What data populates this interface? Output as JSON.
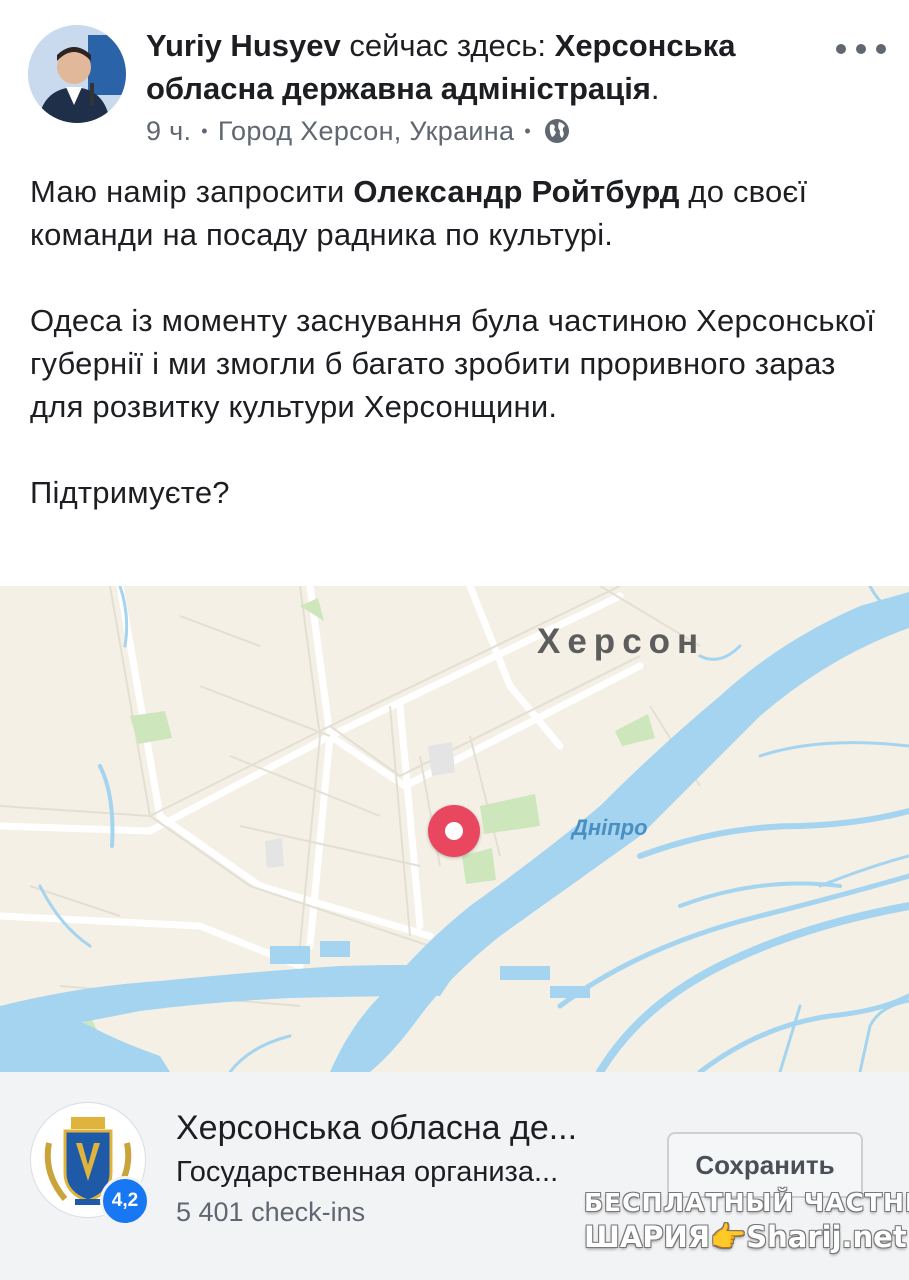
{
  "post": {
    "author": "Yuriy Husyev",
    "action": " сейчас здесь: ",
    "place_link": "Херсонська обласна державна адміністрація",
    "period": ".",
    "time": "9 ч.",
    "location": "Город Херсон, Украина",
    "privacy_icon": "globe-icon",
    "more_icon": "more-options-icon",
    "body": {
      "p1_part1": "Маю намір запросити ",
      "p1_bold": "Олександр Ройтбурд",
      "p1_part2": " до своєї команди на посаду радника по культурі.",
      "p2": "Одеса із моменту заснування була частиною Херсонської губернії і ми змогли б багато зробити проривного зараз для розвитку культури Херсонщини.",
      "p3": "Підтримуєте?"
    }
  },
  "map": {
    "city_label": "Херсон",
    "river_label": "Дніпро",
    "pin_icon": "map-pin-icon",
    "colors": {
      "land": "#f4f0e6",
      "water": "#a4d4ef",
      "park": "#cde6bc",
      "pin": "#e8475f"
    }
  },
  "place_card": {
    "name": "Херсонська обласна де...",
    "category": "Государственная организа...",
    "checkins": "5 401 check-ins",
    "rating": "4,2",
    "save_label": "Сохранить"
  },
  "watermark": {
    "line1": "БЕСПЛАТНЫЙ ЧАСТНЫЙ",
    "line2": "ШАРИЯ👉Sharij.net"
  }
}
